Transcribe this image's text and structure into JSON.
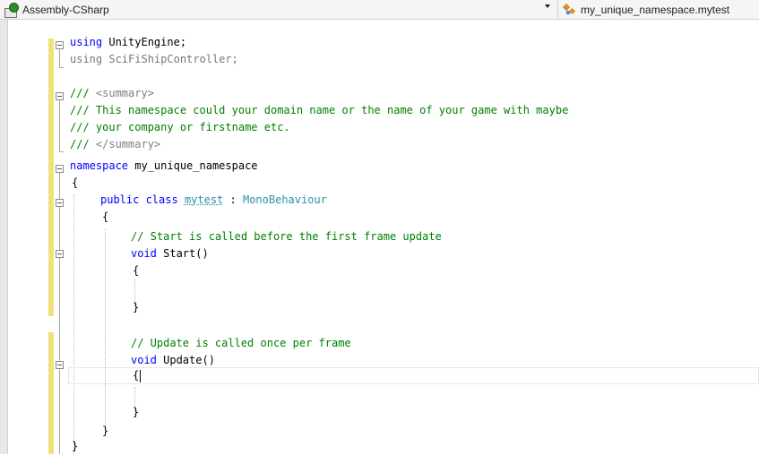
{
  "navbar": {
    "project": "Assembly-CSharp",
    "scope": "my_unique_namespace.mytest"
  },
  "colors": {
    "keyword": "#0000ff",
    "comment": "#008000",
    "xml_doc_tag": "#808080",
    "type_name": "#2b91af",
    "change_bar": "#efe27a"
  },
  "icons": {
    "project": "csharp-project-icon",
    "scope": "class-member-icon",
    "fold": "outline-collapse-icon"
  },
  "code": {
    "l1": {
      "kw": "using",
      "rest": " UnityEngine;"
    },
    "l2": {
      "kw": "using",
      "rest": " SciFiShipController;"
    },
    "l3": {
      "prefix": "/// ",
      "tag": "<summary>"
    },
    "l4": {
      "text": "/// This namespace could your domain name or the name of your game with maybe"
    },
    "l5": {
      "text": "/// your company or firstname etc."
    },
    "l6": {
      "prefix": "/// ",
      "tag": "</summary>"
    },
    "l7": {
      "kw": "namespace",
      "rest": " my_unique_namespace"
    },
    "l8": {
      "text": "{"
    },
    "l9": {
      "kw": "public class",
      "name": "mytest",
      "colon": " : ",
      "base": "MonoBehaviour"
    },
    "l10": {
      "text": "{"
    },
    "l11": {
      "text": "// Start is called before the first frame update"
    },
    "l12": {
      "kw": "void",
      "rest": " Start()"
    },
    "l13": {
      "text": "{"
    },
    "l14": {
      "text": "}"
    },
    "l15": {
      "text": "// Update is called once per frame"
    },
    "l16": {
      "kw": "void",
      "rest": " Update()"
    },
    "l17": {
      "text": "{"
    },
    "l18": {
      "text": "}"
    },
    "l19": {
      "text": "}"
    },
    "l20": {
      "text": "}"
    }
  }
}
